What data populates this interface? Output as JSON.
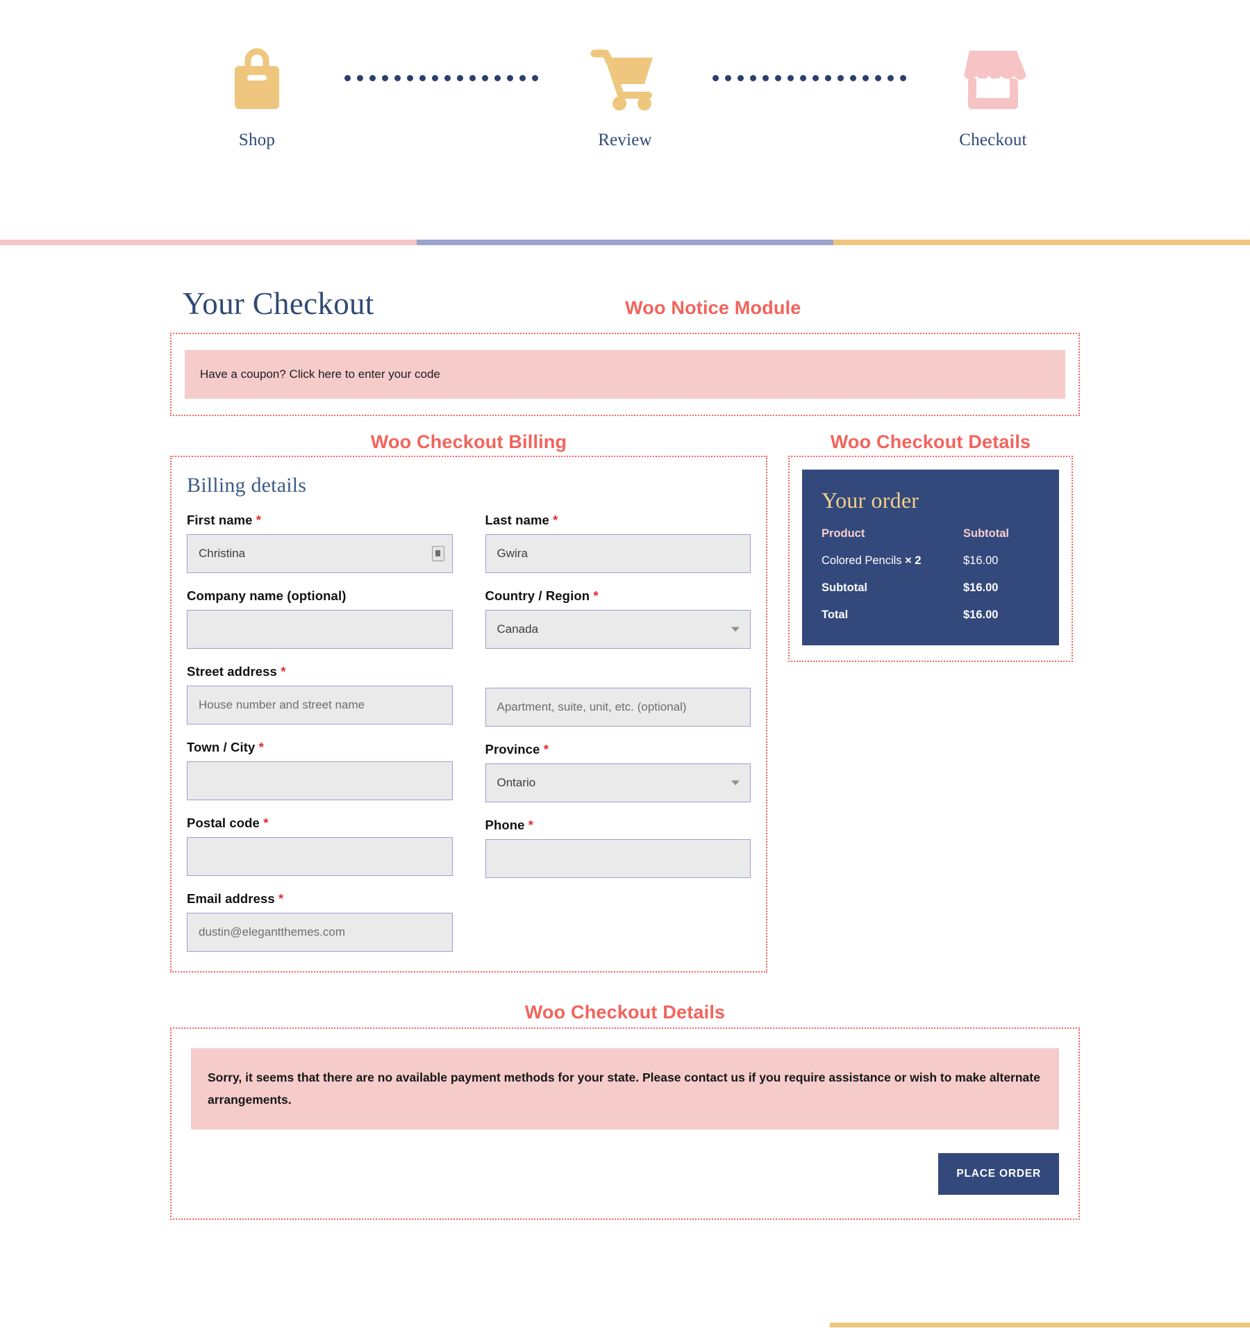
{
  "steps": [
    {
      "label": "Shop",
      "icon": "shopping-bag-icon",
      "color": "#eec67d"
    },
    {
      "label": "Review",
      "icon": "shopping-cart-icon",
      "color": "#eec67d"
    },
    {
      "label": "Checkout",
      "icon": "storefront-icon",
      "color": "#f6c4c4"
    }
  ],
  "rule_colors": {
    "segment1": "#f5c7c7",
    "segment2": "#9aa3cc",
    "segment3": "#eec67d"
  },
  "page": {
    "title": "Your Checkout"
  },
  "module_labels": {
    "notice": "Woo Notice Module",
    "billing": "Woo Checkout Billing",
    "details": "Woo Checkout Details",
    "payment": "Woo Checkout Details"
  },
  "notice": {
    "coupon_text": "Have a coupon? Click here to enter your code"
  },
  "billing": {
    "heading": "Billing details",
    "required_mark": "*",
    "fields": {
      "first_name": {
        "label": "First name",
        "required": true,
        "value": "Christina",
        "placeholder": ""
      },
      "last_name": {
        "label": "Last name",
        "required": true,
        "value": "Gwira",
        "placeholder": ""
      },
      "company": {
        "label": "Company name (optional)",
        "required": false,
        "value": "",
        "placeholder": ""
      },
      "country": {
        "label": "Country / Region",
        "required": true,
        "value": "Canada",
        "options": [
          "Canada"
        ]
      },
      "address_1": {
        "label": "Street address",
        "required": true,
        "value": "",
        "placeholder": "House number and street name"
      },
      "address_2": {
        "label": "",
        "required": false,
        "value": "",
        "placeholder": "Apartment, suite, unit, etc. (optional)"
      },
      "city": {
        "label": "Town / City",
        "required": true,
        "value": "",
        "placeholder": ""
      },
      "province": {
        "label": "Province",
        "required": true,
        "value": "Ontario",
        "options": [
          "Ontario"
        ]
      },
      "postcode": {
        "label": "Postal code",
        "required": true,
        "value": "",
        "placeholder": ""
      },
      "phone": {
        "label": "Phone",
        "required": true,
        "value": "",
        "placeholder": ""
      },
      "email": {
        "label": "Email address",
        "required": true,
        "value": "dustin@elegantthemes.com",
        "placeholder": ""
      }
    }
  },
  "order": {
    "title": "Your order",
    "header": {
      "product": "Product",
      "subtotal": "Subtotal"
    },
    "items": [
      {
        "name": "Colored Pencils",
        "qty": "× 2",
        "subtotal": "$16.00"
      }
    ],
    "totals": [
      {
        "label": "Subtotal",
        "value": "$16.00"
      },
      {
        "label": "Total",
        "value": "$16.00"
      }
    ]
  },
  "payment": {
    "notice": "Sorry, it seems that there are no available payment methods for your state. Please contact us if you require assistance or wish to make alternate arrangements.",
    "place_order_label": "PLACE ORDER"
  },
  "colors": {
    "accent_red": "#f2635c",
    "navy": "#33497c",
    "gold": "#eec67d",
    "pink": "#f6cccb",
    "title_blue": "#2f4a75"
  }
}
